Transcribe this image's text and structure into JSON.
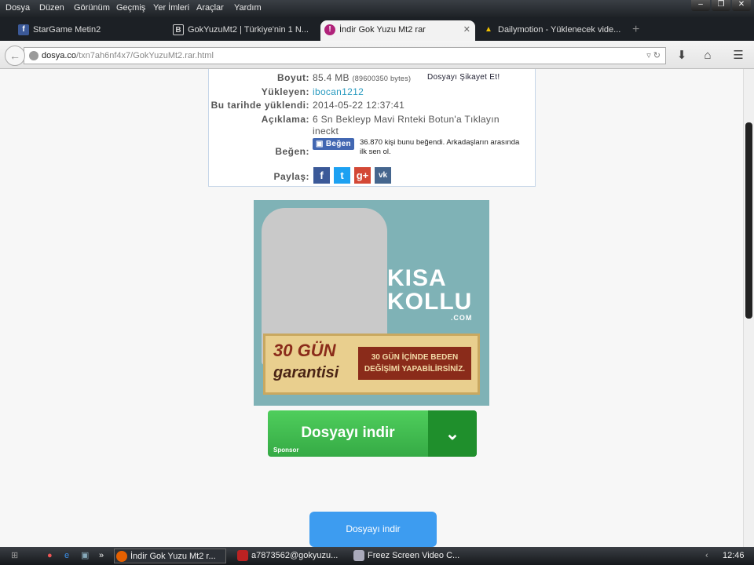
{
  "menu": [
    "Dosya",
    "Düzen",
    "Görünüm",
    "Geçmiş",
    "Yer İmleri",
    "Araçlar",
    "Yardım"
  ],
  "tabs": [
    {
      "title": "StarGame Metin2",
      "icon": "facebook-icon"
    },
    {
      "title": "GokYuzuMt2 | Türkiye'nin 1 N...",
      "icon": "b-icon"
    },
    {
      "title": "İndir Gok Yuzu Mt2 rar",
      "icon": "dosya-icon"
    },
    {
      "title": "Dailymotion - Yüklenecek vide...",
      "icon": "dailymotion-icon"
    }
  ],
  "url": {
    "host": "dosya.co",
    "path": "/txn7ah6nf4x7/GokYuzuMt2.rar.html"
  },
  "info": {
    "size_label": "Boyut:",
    "size": "85.4 MB",
    "bytes": "(89600350 bytes)",
    "report": "Dosyayı Şikayet Et!",
    "uploader_label": "Yükleyen:",
    "uploader": "ibocan1212",
    "date_label": "Bu tarihde yüklendi:",
    "date": "2014-05-22 12:37:41",
    "desc_label": "Açıklama:",
    "desc1": "6 Sn Bekleyp Mavi Rnteki Botun'a Tıklayın",
    "desc2": "ineckt",
    "like_label": "Beğen:",
    "like_button": "Beğen",
    "like_text1": "36.870 kişi bunu beğendi. Arkadaşların arasında",
    "like_text2": "ilk sen ol.",
    "share_label": "Paylaş:"
  },
  "ad": {
    "brand1": "KISA",
    "brand2": "KOLLU",
    ".com": ".COM",
    "g1": "30 GÜN",
    "g2": "garantisi",
    "t1": "30 GÜN İÇİNDE BEDEN",
    "t2": "DEĞİŞİMİ YAPABİLİRSİNİZ."
  },
  "sponsor_button": {
    "label": "Dosyayı indir",
    "sponsor": "Sponsor"
  },
  "download_button": "Dosyayı indir",
  "taskbar": {
    "items": [
      "İndir Gok Yuzu Mt2 r...",
      "a7873562@gokyuzu...",
      "Freez Screen Video C..."
    ],
    "clock": "12:46"
  }
}
